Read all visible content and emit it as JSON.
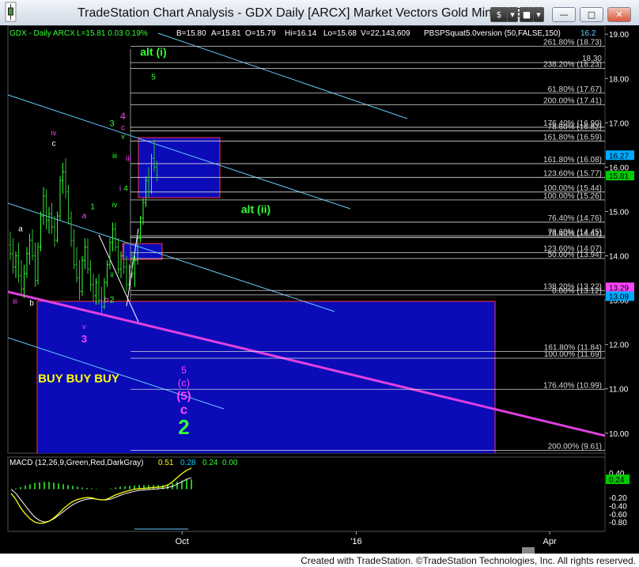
{
  "window": {
    "title": "TradeStation Chart Analysis - GDX Daily [ARCX] Market Vectors Gold Miners ET",
    "buttons": {
      "symbol": "$",
      "chevron": "▾",
      "minimize": "—",
      "maximize": "□",
      "close": "✕"
    }
  },
  "footer": "Created with TradeStation. ©TradeStation Technologies, Inc. All rights reserved.",
  "header_line": {
    "symbol": "GDX - Daily  ARCX",
    "quote": "L=15.81  0.03  0.19%",
    "bid": "B=15.80",
    "ask": "A=15.81",
    "open": "O=15.79",
    "high": "Hi=16.14",
    "low": "Lo=15.68",
    "volume": "V=22,143,609",
    "indicator": "PBSPSquat5.0version (50,FALSE,150)",
    "right_value": "16.2"
  },
  "colors": {
    "up": "#33ff33",
    "pink": "#ff44ff",
    "cyan": "#66ccff",
    "magenta_line": "#e040e0",
    "box_fill": "#0b0bb8",
    "box_edge": "#ff3333"
  },
  "chart_data": {
    "type": "candlestick",
    "price_axis": {
      "range": [
        9.55,
        19.2
      ],
      "ticks": [
        10.0,
        11.0,
        12.0,
        13.0,
        14.0,
        15.0,
        16.0,
        17.0,
        18.0,
        19.0
      ],
      "tick_labels": [
        "10.00",
        "11.00",
        "12.00",
        "13.00",
        "14.00",
        "15.00",
        "16.00",
        "17.00",
        "18.00",
        "19.00"
      ],
      "value_labels": [
        {
          "text": "16.27",
          "value": 16.27,
          "bg": "#00aaff",
          "fg": "#000000"
        },
        {
          "text": "15.81",
          "value": 15.81,
          "bg": "#00cc00",
          "fg": "#000000"
        },
        {
          "text": "13.29",
          "value": 13.29,
          "bg": "#ff44ff",
          "fg": "#000000"
        },
        {
          "text": "13.09",
          "value": 13.09,
          "bg": "#00aaff",
          "fg": "#000000"
        }
      ]
    },
    "time_axis": {
      "labels": [
        {
          "text": "Oct",
          "bar": 63
        },
        {
          "text": "'16",
          "bar": 126
        },
        {
          "text": "Apr",
          "bar": 196
        }
      ],
      "total_bars": 216
    },
    "fib_lines": [
      {
        "label": "261.80% (18.73)",
        "value": 18.73
      },
      {
        "label": "238.20% (18.23)",
        "value": 18.23
      },
      {
        "label": "18.30",
        "value": 18.36
      },
      {
        "label": "61.80% (17.67)",
        "value": 17.67
      },
      {
        "label": "200.00% (17.41)",
        "value": 17.41
      },
      {
        "label": "176.40% (16.90)",
        "value": 16.9
      },
      {
        "label": "78.60% (16.82)",
        "value": 16.82
      },
      {
        "label": "161.80% (16.59)",
        "value": 16.59
      },
      {
        "label": "161.80% (16.08)",
        "value": 16.08
      },
      {
        "label": "123.60% (15.77)",
        "value": 15.77
      },
      {
        "label": "100.00% (15.44)",
        "value": 15.44
      },
      {
        "label": "100.00% (15.26)",
        "value": 15.26
      },
      {
        "label": "76.40% (14.76)",
        "value": 14.76
      },
      {
        "label": "78.60% (14.45)",
        "value": 14.45
      },
      {
        "label": "76.40% (14.41)",
        "value": 14.41
      },
      {
        "label": "123.60% (14.07)",
        "value": 14.07
      },
      {
        "label": "50.00% (13.94)",
        "value": 13.94
      },
      {
        "label": "138.20% (13.22)",
        "value": 13.22
      },
      {
        "label": "0.00% (13.12)",
        "value": 13.12
      },
      {
        "label": "161.80% (11.84)",
        "value": 11.84
      },
      {
        "label": "100.00% (11.69)",
        "value": 11.69
      },
      {
        "label": "176.40% (10.99)",
        "value": 10.99
      },
      {
        "label": "200.00% (9.61)",
        "value": 9.61
      }
    ],
    "candles": [
      [
        14.25,
        14.55,
        13.9,
        14.05
      ],
      [
        14.05,
        14.4,
        13.6,
        13.75
      ],
      [
        13.75,
        14.1,
        13.5,
        14.0
      ],
      [
        14.0,
        14.3,
        13.4,
        13.55
      ],
      [
        13.55,
        13.9,
        13.1,
        13.25
      ],
      [
        13.25,
        13.8,
        13.05,
        13.6
      ],
      [
        13.6,
        14.2,
        13.5,
        14.05
      ],
      [
        14.05,
        14.5,
        13.8,
        14.35
      ],
      [
        14.35,
        14.6,
        13.9,
        14.0
      ],
      [
        14.0,
        14.3,
        13.3,
        13.45
      ],
      [
        13.45,
        14.3,
        13.35,
        14.2
      ],
      [
        14.2,
        15.0,
        14.1,
        14.9
      ],
      [
        14.9,
        15.55,
        14.7,
        15.35
      ],
      [
        15.35,
        15.5,
        14.6,
        14.8
      ],
      [
        14.8,
        15.1,
        14.5,
        14.95
      ],
      [
        14.95,
        15.2,
        14.5,
        14.65
      ],
      [
        14.65,
        14.9,
        14.2,
        14.35
      ],
      [
        14.35,
        15.0,
        14.3,
        14.9
      ],
      [
        14.9,
        15.8,
        14.8,
        15.7
      ],
      [
        15.7,
        16.1,
        15.4,
        15.9
      ],
      [
        15.9,
        16.2,
        15.3,
        15.45
      ],
      [
        15.45,
        15.6,
        14.7,
        14.85
      ],
      [
        14.85,
        15.0,
        14.2,
        14.35
      ],
      [
        14.35,
        14.6,
        13.7,
        13.8
      ],
      [
        13.8,
        14.2,
        13.4,
        13.5
      ],
      [
        13.5,
        13.9,
        13.0,
        13.2
      ],
      [
        13.2,
        14.0,
        13.1,
        13.9
      ],
      [
        13.9,
        14.4,
        13.7,
        14.2
      ],
      [
        14.2,
        14.4,
        13.6,
        13.7
      ],
      [
        13.7,
        13.9,
        13.2,
        13.35
      ],
      [
        13.35,
        13.6,
        12.95,
        13.1
      ],
      [
        13.1,
        13.5,
        12.9,
        13.4
      ],
      [
        13.4,
        13.6,
        12.9,
        13.0
      ],
      [
        13.0,
        13.3,
        12.7,
        12.85
      ],
      [
        12.85,
        13.5,
        12.8,
        13.4
      ],
      [
        13.4,
        13.9,
        13.3,
        13.8
      ],
      [
        13.8,
        14.4,
        13.7,
        14.3
      ],
      [
        14.3,
        14.75,
        14.1,
        14.6
      ],
      [
        14.6,
        14.75,
        14.1,
        14.2
      ],
      [
        14.2,
        14.4,
        13.6,
        13.7
      ],
      [
        13.7,
        14.1,
        13.5,
        14.0
      ],
      [
        14.0,
        14.3,
        13.6,
        13.75
      ],
      [
        13.75,
        14.0,
        13.2,
        13.35
      ],
      [
        13.35,
        13.8,
        13.3,
        13.75
      ],
      [
        13.75,
        14.1,
        13.5,
        13.6
      ],
      [
        13.6,
        14.0,
        13.3,
        13.9
      ],
      [
        13.9,
        14.5,
        13.8,
        14.4
      ],
      [
        14.4,
        14.9,
        14.3,
        14.85
      ],
      [
        14.85,
        15.3,
        14.7,
        15.2
      ],
      [
        15.2,
        15.8,
        15.1,
        15.7
      ],
      [
        15.7,
        16.0,
        15.3,
        15.45
      ],
      [
        15.45,
        16.3,
        15.4,
        16.2
      ],
      [
        16.2,
        16.62,
        15.9,
        16.0
      ],
      [
        16.0,
        16.14,
        15.68,
        15.81
      ]
    ],
    "macd": {
      "label": "MACD (12,26,9,Green,Red,DarkGray)",
      "values_text": {
        "macd": "0.51",
        "signal": "0.28",
        "hist": "0.24",
        "zero": "0.00"
      },
      "range": [
        -0.95,
        0.55
      ],
      "ticks": [
        0.4,
        -0.2,
        -0.4,
        -0.6,
        -0.8
      ],
      "tick_labels": [
        "0.40",
        "-0.20",
        "-0.40",
        "-0.60",
        "-0.80"
      ],
      "value_label": "0.24",
      "macd_line": [
        -0.1,
        -0.25,
        -0.45,
        -0.6,
        -0.72,
        -0.8,
        -0.83,
        -0.82,
        -0.78,
        -0.7,
        -0.6,
        -0.48,
        -0.38,
        -0.3,
        -0.25,
        -0.22,
        -0.2,
        -0.21,
        -0.24,
        -0.26,
        -0.25,
        -0.2,
        -0.14,
        -0.1,
        -0.06,
        -0.03,
        0.0,
        0.01,
        0.02,
        0.03,
        0.04,
        0.05,
        0.06,
        0.1,
        0.18,
        0.28,
        0.38,
        0.46,
        0.51
      ],
      "signal_line": [
        0.0,
        -0.1,
        -0.25,
        -0.4,
        -0.55,
        -0.68,
        -0.76,
        -0.8,
        -0.78,
        -0.72,
        -0.64,
        -0.55,
        -0.46,
        -0.38,
        -0.32,
        -0.27,
        -0.24,
        -0.23,
        -0.24,
        -0.26,
        -0.26,
        -0.24,
        -0.2,
        -0.15,
        -0.11,
        -0.08,
        -0.05,
        -0.03,
        -0.02,
        -0.01,
        0.0,
        0.01,
        0.02,
        0.04,
        0.07,
        0.12,
        0.18,
        0.24,
        0.28
      ],
      "hist": [
        0.0,
        0.02,
        0.05,
        0.09,
        0.12,
        0.15,
        0.17,
        0.18,
        0.18,
        0.16,
        0.14,
        0.12,
        0.1,
        0.08,
        0.06,
        0.04,
        0.03,
        0.02,
        0.01,
        0.0,
        0.0,
        0.02,
        0.04,
        0.06,
        0.07,
        0.08,
        0.09,
        0.1,
        0.1,
        0.1,
        0.1,
        0.1,
        0.1,
        0.12,
        0.15,
        0.18,
        0.21,
        0.23,
        0.24
      ]
    }
  },
  "annotations": [
    {
      "text": "alt (i)",
      "color": "#33ff33",
      "size": 14,
      "bold": true,
      "bar": 52,
      "value": 18.51
    },
    {
      "text": "5",
      "color": "#33ff33",
      "size": 10,
      "bar": 52,
      "value": 17.98
    },
    {
      "text": "3",
      "color": "#33ff33",
      "size": 11,
      "bar": 37,
      "value": 16.93
    },
    {
      "text": "4",
      "color": "#ff44ff",
      "size": 12,
      "bar": 41,
      "value": 17.08
    },
    {
      "text": "c",
      "color": "#ff44ff",
      "size": 10,
      "bar": 41,
      "value": 16.84
    },
    {
      "text": "v",
      "color": "#33ff33",
      "size": 9,
      "bar": 41,
      "value": 16.64
    },
    {
      "text": "iii",
      "color": "#33ff33",
      "size": 9,
      "bar": 38,
      "value": 16.2
    },
    {
      "text": "iii",
      "color": "#ff44ff",
      "size": 10,
      "bar": 43,
      "value": 16.14
    },
    {
      "text": "i",
      "color": "#ff44ff",
      "size": 10,
      "bar": 40,
      "value": 15.46
    },
    {
      "text": "4",
      "color": "#33ff33",
      "size": 10,
      "bar": 42,
      "value": 15.46
    },
    {
      "text": "iv",
      "color": "#33ff33",
      "size": 9,
      "bar": 38,
      "value": 15.1
    },
    {
      "text": "alt (ii)",
      "color": "#33ff33",
      "size": 14,
      "bold": true,
      "bar": 89,
      "value": 14.96
    },
    {
      "text": "1",
      "color": "#33ff33",
      "size": 10,
      "bar": 30,
      "value": 15.05
    },
    {
      "text": "a",
      "color": "#ff44ff",
      "size": 10,
      "bar": 27,
      "value": 14.85
    },
    {
      "text": "ii",
      "color": "#33ff33",
      "size": 9,
      "bar": 37,
      "value": 13.52
    },
    {
      "text": "b",
      "color": "#ff44ff",
      "size": 10,
      "bar": 35,
      "value": 12.95
    },
    {
      "text": "2",
      "color": "#33ff33",
      "size": 11,
      "bar": 37,
      "value": 12.95
    },
    {
      "text": "iv",
      "color": "#ff44ff",
      "size": 9,
      "bar": 16,
      "value": 16.72
    },
    {
      "text": "c",
      "color": "#ffffff",
      "size": 10,
      "bar": 16,
      "value": 16.48
    },
    {
      "text": "a",
      "color": "#ffffff",
      "size": 10,
      "bar": 4,
      "value": 14.55
    },
    {
      "text": "iii",
      "color": "#ff44ff",
      "size": 9,
      "bar": 2,
      "value": 12.92
    },
    {
      "text": "b",
      "color": "#ffffff",
      "size": 10,
      "bar": 8,
      "value": 12.88
    },
    {
      "text": "v",
      "color": "#ff44ff",
      "size": 9,
      "bar": 27,
      "value": 12.35
    },
    {
      "text": "3",
      "color": "#ff44ff",
      "size": 13,
      "bold": true,
      "bar": 27,
      "value": 12.05
    },
    {
      "text": "BUY  BUY   BUY",
      "color": "#ffff00",
      "size": 15,
      "bold": true,
      "bar": 25,
      "value": 11.15
    },
    {
      "text": "5",
      "color": "#ff44ff",
      "size": 12,
      "bar": 63,
      "value": 11.35
    },
    {
      "text": "(c)",
      "color": "#ff44ff",
      "size": 13,
      "bar": 63,
      "value": 11.06
    },
    {
      "text": "(5)",
      "color": "#ff44ff",
      "size": 15,
      "bold": true,
      "bar": 63,
      "value": 10.75
    },
    {
      "text": "c",
      "color": "#ff44ff",
      "size": 17,
      "bold": true,
      "bar": 63,
      "value": 10.43
    },
    {
      "text": "2",
      "color": "#33ff33",
      "size": 26,
      "bold": true,
      "bar": 63,
      "value": 9.98
    }
  ]
}
